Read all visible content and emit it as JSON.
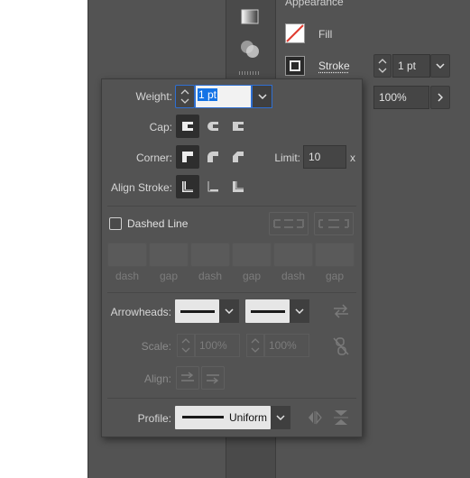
{
  "appearance": {
    "title": "Appearance",
    "fill_label": "Fill",
    "stroke_label": "Stroke",
    "stroke_weight": "1 pt",
    "opacity": "100%"
  },
  "stroke_panel": {
    "weight_label": "Weight:",
    "weight_value": "1 pt",
    "cap_label": "Cap:",
    "corner_label": "Corner:",
    "limit_label": "Limit:",
    "limit_value": "10",
    "limit_unit": "x",
    "align_stroke_label": "Align Stroke:",
    "dashed_line_label": "Dashed Line",
    "dash_labels": [
      "dash",
      "gap",
      "dash",
      "gap",
      "dash",
      "gap"
    ],
    "arrowheads_label": "Arrowheads:",
    "scale_label": "Scale:",
    "scale_start": "100%",
    "scale_end": "100%",
    "align_label": "Align:",
    "profile_label": "Profile:",
    "profile_value": "Uniform"
  },
  "colors": {
    "panel_bg": "#535353",
    "selected_text_bg": "#1473e6",
    "fill_swatch_slash": "#e03a2f"
  },
  "icons": [
    "gradient-icon",
    "transparency-icon",
    "fill-none-swatch-icon",
    "stroke-swatch-icon",
    "chevron-down-icon",
    "chevron-right-icon",
    "swap-arrowheads-icon",
    "link-scale-icon",
    "flip-profile-icon"
  ]
}
